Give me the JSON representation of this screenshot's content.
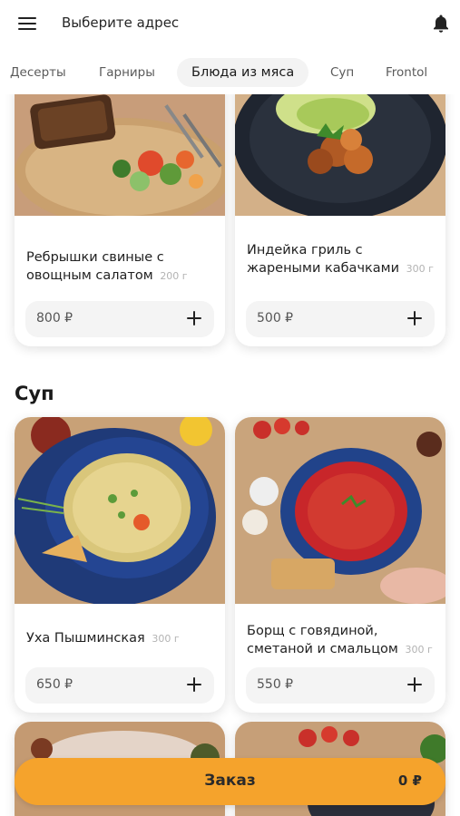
{
  "header": {
    "address_label": "Выберите адрес",
    "menu_icon": "hamburger-icon",
    "bell_icon": "bell-icon"
  },
  "tabs": [
    {
      "label": "Десерты",
      "active": false
    },
    {
      "label": "Гарниры",
      "active": false
    },
    {
      "label": "Блюда из мяса",
      "active": true
    },
    {
      "label": "Суп",
      "active": false
    },
    {
      "label": "Frontol",
      "active": false
    }
  ],
  "meat_section": {
    "items": [
      {
        "name": "Ребрышки свиные с овощным салатом",
        "weight": "200 г",
        "price": "800 ₽"
      },
      {
        "name": "Индейка гриль с жареными кабачками",
        "weight": "300 г",
        "price": "500 ₽"
      }
    ]
  },
  "soup_section": {
    "title": "Суп",
    "items": [
      {
        "name": "Уха Пышминская",
        "weight": "300 г",
        "price": "650 ₽"
      },
      {
        "name": "Борщ с говядиной, сметаной и смальцом",
        "weight": "300 г",
        "price": "550 ₽"
      }
    ]
  },
  "order": {
    "label": "Заказ",
    "total": "0 ₽"
  },
  "colors": {
    "accent": "#f5a32c",
    "pill_bg": "#f4f4f4"
  }
}
